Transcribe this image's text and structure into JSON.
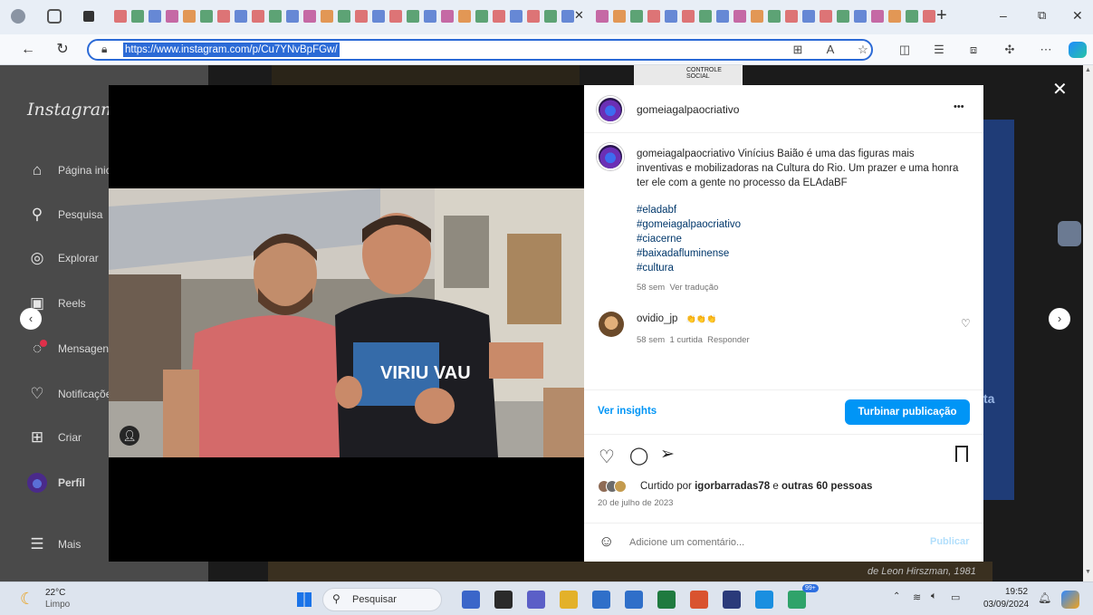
{
  "browser": {
    "url": "https://www.instagram.com/p/Cu7YNvBpFGw/",
    "new_tab": "+",
    "minimize": "–",
    "restore": "⧉",
    "close": "✕"
  },
  "sidebar": {
    "logo": "Instagram",
    "items": [
      {
        "label": "Página inicial",
        "icon": "home-icon"
      },
      {
        "label": "Pesquisa",
        "icon": "search-icon"
      },
      {
        "label": "Explorar",
        "icon": "compass-icon"
      },
      {
        "label": "Reels",
        "icon": "reels-icon"
      },
      {
        "label": "Mensagens",
        "icon": "messenger-icon"
      },
      {
        "label": "Notificações",
        "icon": "heart-icon"
      },
      {
        "label": "Criar",
        "icon": "plus-square-icon"
      },
      {
        "label": "Perfil",
        "icon": "profile-avatar"
      },
      {
        "label": "Mais",
        "icon": "menu-icon"
      }
    ]
  },
  "post": {
    "author": "gomeiagalpaocriativo",
    "caption_author": "gomeiagalpaocriativo",
    "caption": "Vinícius Baião é uma das figuras mais inventivas e mobilizadoras na Cultura do Rio. Um prazer e uma honra ter ele com a gente no processo da ELAdaBF",
    "hashtags": [
      "#eladabf",
      "#gomeiagalpaocriativo",
      "#ciacerne",
      "#baixadafluminense",
      "#cultura"
    ],
    "caption_age": "58 sem",
    "caption_translate": "Ver tradução",
    "more": "•••"
  },
  "comment": {
    "author": "ovidio_jp",
    "text": "👏👏👏",
    "age": "58 sem",
    "likes": "1 curtida",
    "reply": "Responder"
  },
  "actions": {
    "insights": "Ver insights",
    "boost": "Turbinar publicação",
    "liked_prefix": "Curtido por ",
    "liked_user": "igorbarradas78",
    "liked_mid": " e ",
    "liked_others": "outras 60 pessoas",
    "date": "20 de julho de 2023",
    "comment_placeholder": "Adicione um comentário...",
    "publish": "Publicar"
  },
  "photo": {
    "shirt_text": "VIRIU VAU"
  },
  "background": {
    "sign1": "CONTROLE SOCIAL",
    "poster_text": "ta",
    "bottom_text": "de Leon Hirszman, 1981"
  },
  "taskbar": {
    "weather_temp": "22°C",
    "weather_desc": "Limpo",
    "search_placeholder": "Pesquisar",
    "time": "19:52",
    "date": "03/09/2024",
    "badge": "99+"
  },
  "colors": {
    "accent": "#0095f6",
    "link": "#00376b",
    "url_highlight": "#2b6ad6"
  }
}
